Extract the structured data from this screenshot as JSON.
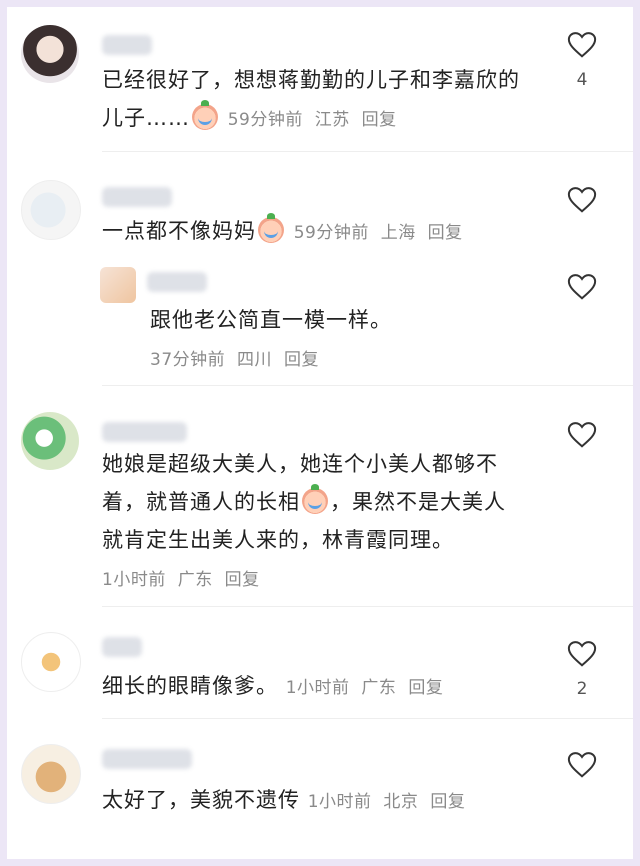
{
  "comments": [
    {
      "text_line1": "已经很好了，想想蒋勤勤的儿子和李嘉欣的",
      "text_line2": "儿子……",
      "time": "59分钟前",
      "location": "江苏",
      "reply": "回复",
      "likes": "4"
    },
    {
      "text": "一点都不像妈妈",
      "time": "59分钟前",
      "location": "上海",
      "reply": "回复",
      "likes": ""
    },
    {
      "text": "跟他老公简直一模一样。",
      "time": "37分钟前",
      "location": "四川",
      "reply": "回复",
      "likes": ""
    },
    {
      "text_line1": "她娘是超级大美人，她连个小美人都够不",
      "text_line2a": "着，就普通人的长相",
      "text_line2b": "，果然不是大美人",
      "text_line3": "就肯定生出美人来的，林青霞同理。",
      "time": "1小时前",
      "location": "广东",
      "reply": "回复",
      "likes": ""
    },
    {
      "text": "细长的眼睛像爹。",
      "time": "1小时前",
      "location": "广东",
      "reply": "回复",
      "likes": "2"
    },
    {
      "text": "太好了，美貌不遗传",
      "time": "1小时前",
      "location": "北京",
      "reply": "回复",
      "likes": ""
    }
  ],
  "icons": {
    "like": "heart-outline-icon",
    "emoji": "crying-laughing-emoji"
  },
  "colors": {
    "background": "#ece6f6",
    "card": "#ffffff",
    "text": "#222222",
    "meta": "#8a8a8a"
  }
}
